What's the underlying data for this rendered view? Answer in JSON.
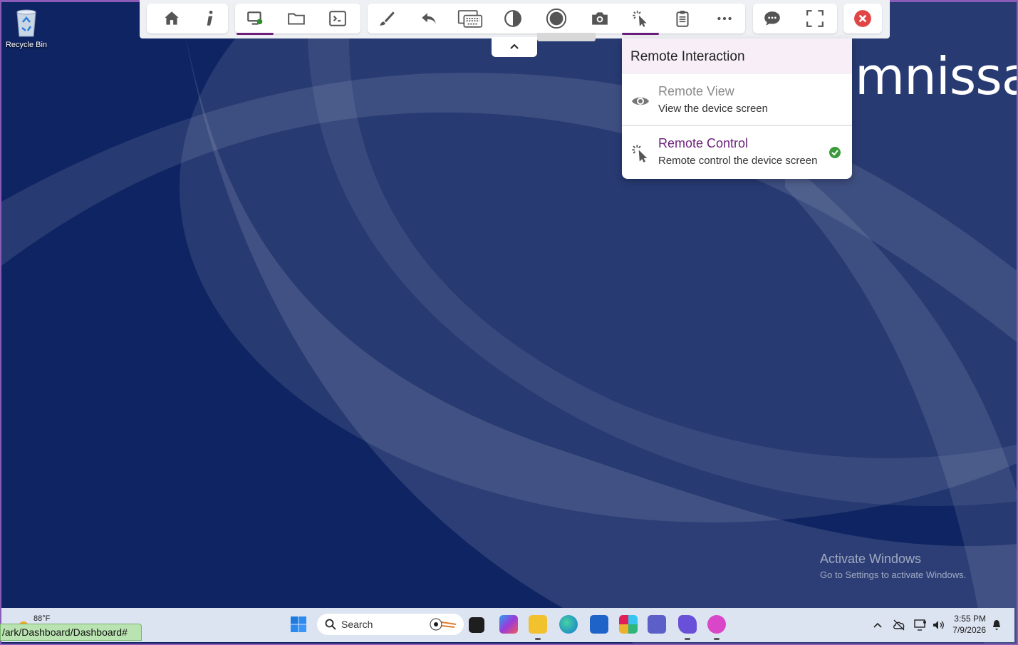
{
  "desktop": {
    "recycle_bin_label": "Recycle Bin",
    "brand_text": "mnissa",
    "brand_mark": "®",
    "activate_title": "Activate Windows",
    "activate_sub": "Go to Settings to activate Windows."
  },
  "toolbar": {
    "groups": [
      [
        "home-icon",
        "info-icon"
      ],
      [
        "remote-desktop-icon",
        "folder-icon",
        "terminal-icon"
      ],
      [
        "brush-icon",
        "undo-icon",
        "keyboard-icon",
        "contrast-icon",
        "record-icon",
        "camera-icon",
        "remote-interaction-icon",
        "clipboard-icon",
        "more-icon"
      ],
      [
        "chat-icon",
        "fullscreen-icon"
      ],
      [
        "close-icon"
      ]
    ],
    "active": [
      "remote-desktop-icon",
      "remote-interaction-icon"
    ],
    "accent_color": "#6b1f7a"
  },
  "dropdown": {
    "title": "Remote Interaction",
    "options": [
      {
        "title": "Remote View",
        "subtitle": "View the device screen",
        "icon": "eye-icon",
        "selected": false
      },
      {
        "title": "Remote Control",
        "subtitle": "Remote control the device screen",
        "icon": "pointer-click-icon",
        "selected": true
      }
    ]
  },
  "taskbar": {
    "weather_temp": "88°F",
    "url_status": "/ark/Dashboard/Dashboard#",
    "search_placeholder": "Search",
    "time": "3:55 PM",
    "date": "7/9/2026",
    "apps": [
      "start-icon",
      "widgets-icon",
      "m365-icon",
      "file-explorer-icon",
      "edge-icon",
      "store-icon",
      "slack-icon",
      "teams-icon",
      "viva-icon",
      "copilot-icon"
    ],
    "tray": [
      "chevron-up-icon",
      "cloud-off-icon",
      "network-icon",
      "volume-icon",
      "notification-icon"
    ]
  }
}
